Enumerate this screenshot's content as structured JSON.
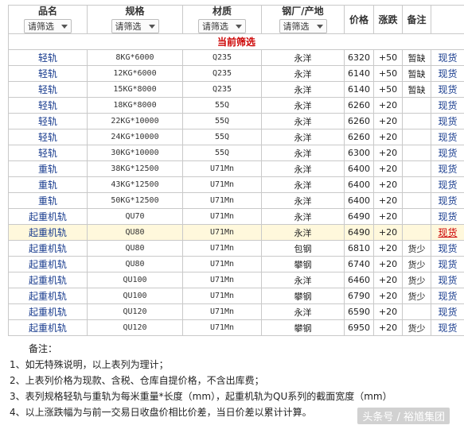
{
  "headers": [
    {
      "label": "品名",
      "filter": "请筛选"
    },
    {
      "label": "规格",
      "filter": "请筛选"
    },
    {
      "label": "材质",
      "filter": "请筛选"
    },
    {
      "label": "钢厂/产地",
      "filter": "请筛选"
    },
    {
      "label": "价格"
    },
    {
      "label": "涨跌"
    },
    {
      "label": "备注"
    }
  ],
  "current_filter_label": "当前筛选",
  "rows": [
    {
      "name": "轻轨",
      "spec": "8KG*6000",
      "material": "Q235",
      "plant": "永洋",
      "price": "6320",
      "change": "+50",
      "note": "暂缺",
      "stock": "现货"
    },
    {
      "name": "轻轨",
      "spec": "12KG*6000",
      "material": "Q235",
      "plant": "永洋",
      "price": "6140",
      "change": "+50",
      "note": "暂缺",
      "stock": "现货"
    },
    {
      "name": "轻轨",
      "spec": "15KG*8000",
      "material": "Q235",
      "plant": "永洋",
      "price": "6140",
      "change": "+50",
      "note": "暂缺",
      "stock": "现货"
    },
    {
      "name": "轻轨",
      "spec": "18KG*8000",
      "material": "55Q",
      "plant": "永洋",
      "price": "6260",
      "change": "+20",
      "note": "",
      "stock": "现货"
    },
    {
      "name": "轻轨",
      "spec": "22KG*10000",
      "material": "55Q",
      "plant": "永洋",
      "price": "6260",
      "change": "+20",
      "note": "",
      "stock": "现货"
    },
    {
      "name": "轻轨",
      "spec": "24KG*10000",
      "material": "55Q",
      "plant": "永洋",
      "price": "6260",
      "change": "+20",
      "note": "",
      "stock": "现货"
    },
    {
      "name": "轻轨",
      "spec": "30KG*10000",
      "material": "55Q",
      "plant": "永洋",
      "price": "6300",
      "change": "+20",
      "note": "",
      "stock": "现货"
    },
    {
      "name": "重轨",
      "spec": "38KG*12500",
      "material": "U71Mn",
      "plant": "永洋",
      "price": "6400",
      "change": "+20",
      "note": "",
      "stock": "现货"
    },
    {
      "name": "重轨",
      "spec": "43KG*12500",
      "material": "U71Mn",
      "plant": "永洋",
      "price": "6400",
      "change": "+20",
      "note": "",
      "stock": "现货"
    },
    {
      "name": "重轨",
      "spec": "50KG*12500",
      "material": "U71Mn",
      "plant": "永洋",
      "price": "6400",
      "change": "+20",
      "note": "",
      "stock": "现货"
    },
    {
      "name": "起重机轨",
      "spec": "QU70",
      "material": "U71Mn",
      "plant": "永洋",
      "price": "6490",
      "change": "+20",
      "note": "",
      "stock": "现货"
    },
    {
      "name": "起重机轨",
      "spec": "QU80",
      "material": "U71Mn",
      "plant": "永洋",
      "price": "6490",
      "change": "+20",
      "note": "",
      "stock": "现货"
    },
    {
      "name": "起重机轨",
      "spec": "QU80",
      "material": "U71Mn",
      "plant": "包钢",
      "price": "6810",
      "change": "+20",
      "note": "货少",
      "stock": "现货"
    },
    {
      "name": "起重机轨",
      "spec": "QU80",
      "material": "U71Mn",
      "plant": "攀钢",
      "price": "6740",
      "change": "+20",
      "note": "货少",
      "stock": "现货"
    },
    {
      "name": "起重机轨",
      "spec": "QU100",
      "material": "U71Mn",
      "plant": "永洋",
      "price": "6460",
      "change": "+20",
      "note": "货少",
      "stock": "现货"
    },
    {
      "name": "起重机轨",
      "spec": "QU100",
      "material": "U71Mn",
      "plant": "攀钢",
      "price": "6790",
      "change": "+20",
      "note": "货少",
      "stock": "现货"
    },
    {
      "name": "起重机轨",
      "spec": "QU120",
      "material": "U71Mn",
      "plant": "永洋",
      "price": "6590",
      "change": "+20",
      "note": "",
      "stock": "现货"
    },
    {
      "name": "起重机轨",
      "spec": "QU120",
      "material": "U71Mn",
      "plant": "攀钢",
      "price": "6950",
      "change": "+20",
      "note": "货少",
      "stock": "现货"
    }
  ],
  "notes_title": "备注：",
  "notes": [
    "1、如无特殊说明，以上表列为理计；",
    "2、上表列价格为现款、含税、仓库自提价格，不含出库费；",
    "3、表列规格轻轨与重轨为每米重量*长度（mm），起重机轨为QU系列的截面宽度（mm）",
    "4、以上涨跌幅为与前一交易日收盘价相比价差，当日价差以累计计算。"
  ],
  "watermark": "头条号 / 裕馗集团"
}
